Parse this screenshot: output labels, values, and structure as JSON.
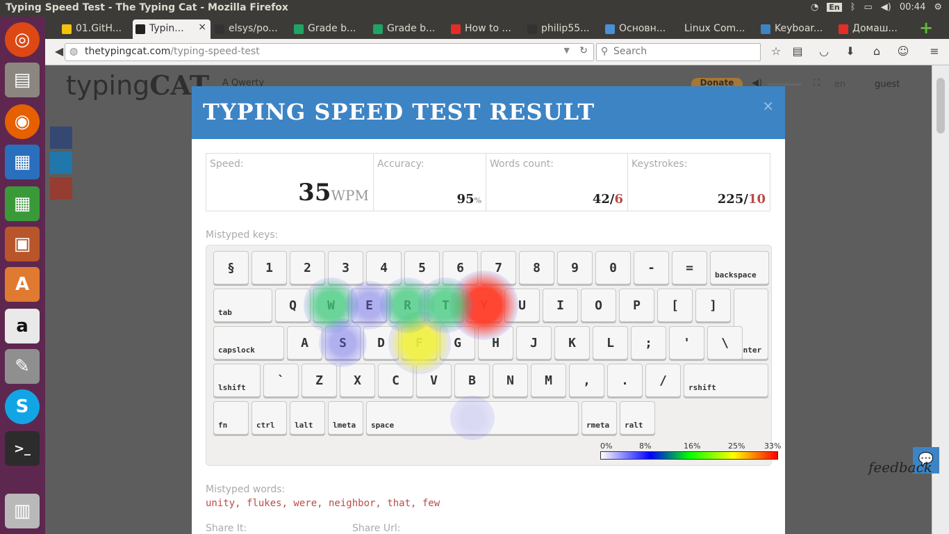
{
  "window_title": "Typing Speed Test - The Typing Cat - Mozilla Firefox",
  "tray": {
    "keyboard": "En",
    "clock": "00:44"
  },
  "tabs": [
    {
      "label": "01.GitH...",
      "color": "#f4c20d"
    },
    {
      "label": "Typin...",
      "color": "#222222",
      "active": true
    },
    {
      "label": "elsys/po...",
      "color": "#333333"
    },
    {
      "label": "Grade b...",
      "color": "#1fa463"
    },
    {
      "label": "Grade b...",
      "color": "#1fa463"
    },
    {
      "label": "How to ...",
      "color": "#e52d27"
    },
    {
      "label": "philip55...",
      "color": "#333333"
    },
    {
      "label": "Основн...",
      "color": "#4a90d9"
    },
    {
      "label": "Linux Com...",
      "color": ""
    },
    {
      "label": "Keyboar...",
      "color": "#3d84c5"
    },
    {
      "label": "Домаш...",
      "color": "#e52d27"
    }
  ],
  "url": {
    "host": "thetypingcat.com",
    "path": "/typing-speed-test"
  },
  "search_placeholder": "Search",
  "site": {
    "logo_light": "typing",
    "logo_bold": "CAT",
    "layout": "A Qwerty",
    "donate": "Donate",
    "lang": "en",
    "user": "guest",
    "feedback": "feedback"
  },
  "modal": {
    "title": "TYPING SPEED TEST RESULT",
    "close": "×",
    "speed": {
      "label": "Speed:",
      "value": "35",
      "unit": "WPM"
    },
    "accuracy": {
      "label": "Accuracy:",
      "value": "95",
      "unit": "%"
    },
    "words": {
      "label": "Words count:",
      "value": "42",
      "errors": "6"
    },
    "keystrokes": {
      "label": "Keystrokes:",
      "value": "225",
      "errors": "10"
    },
    "mistyped_keys_label": "Mistyped keys:",
    "mistyped_words_label": "Mistyped words:",
    "mistyped_words": "unity, flukes, were, neighbor, that, few",
    "share_label": "Share It:",
    "share_url_label": "Share Url:"
  },
  "keyboard": {
    "rows": [
      [
        "§",
        "1",
        "2",
        "3",
        "4",
        "5",
        "6",
        "7",
        "8",
        "9",
        "0",
        "-",
        "=",
        "backspace"
      ],
      [
        "tab",
        "Q",
        "W",
        "E",
        "R",
        "T",
        "Y",
        "U",
        "I",
        "O",
        "P",
        "[",
        "]",
        "enter"
      ],
      [
        "capslock",
        "A",
        "S",
        "D",
        "F",
        "G",
        "H",
        "J",
        "K",
        "L",
        ";",
        "'",
        "\\"
      ],
      [
        "lshift",
        "`",
        "Z",
        "X",
        "C",
        "V",
        "B",
        "N",
        "M",
        ",",
        ".",
        "/",
        "rshift"
      ],
      [
        "fn",
        "ctrl",
        "lalt",
        "lmeta",
        "space",
        "rmeta",
        "ralt"
      ]
    ],
    "heat": [
      {
        "key": "Y",
        "percent": 33
      },
      {
        "key": "F",
        "percent": 25
      },
      {
        "key": "W",
        "percent": 16
      },
      {
        "key": "R",
        "percent": 16
      },
      {
        "key": "T",
        "percent": 16
      },
      {
        "key": "S",
        "percent": 8
      },
      {
        "key": "E",
        "percent": 8
      },
      {
        "key": "space",
        "percent": 4
      }
    ],
    "legend": [
      "0%",
      "8%",
      "16%",
      "25%",
      "33%"
    ]
  }
}
